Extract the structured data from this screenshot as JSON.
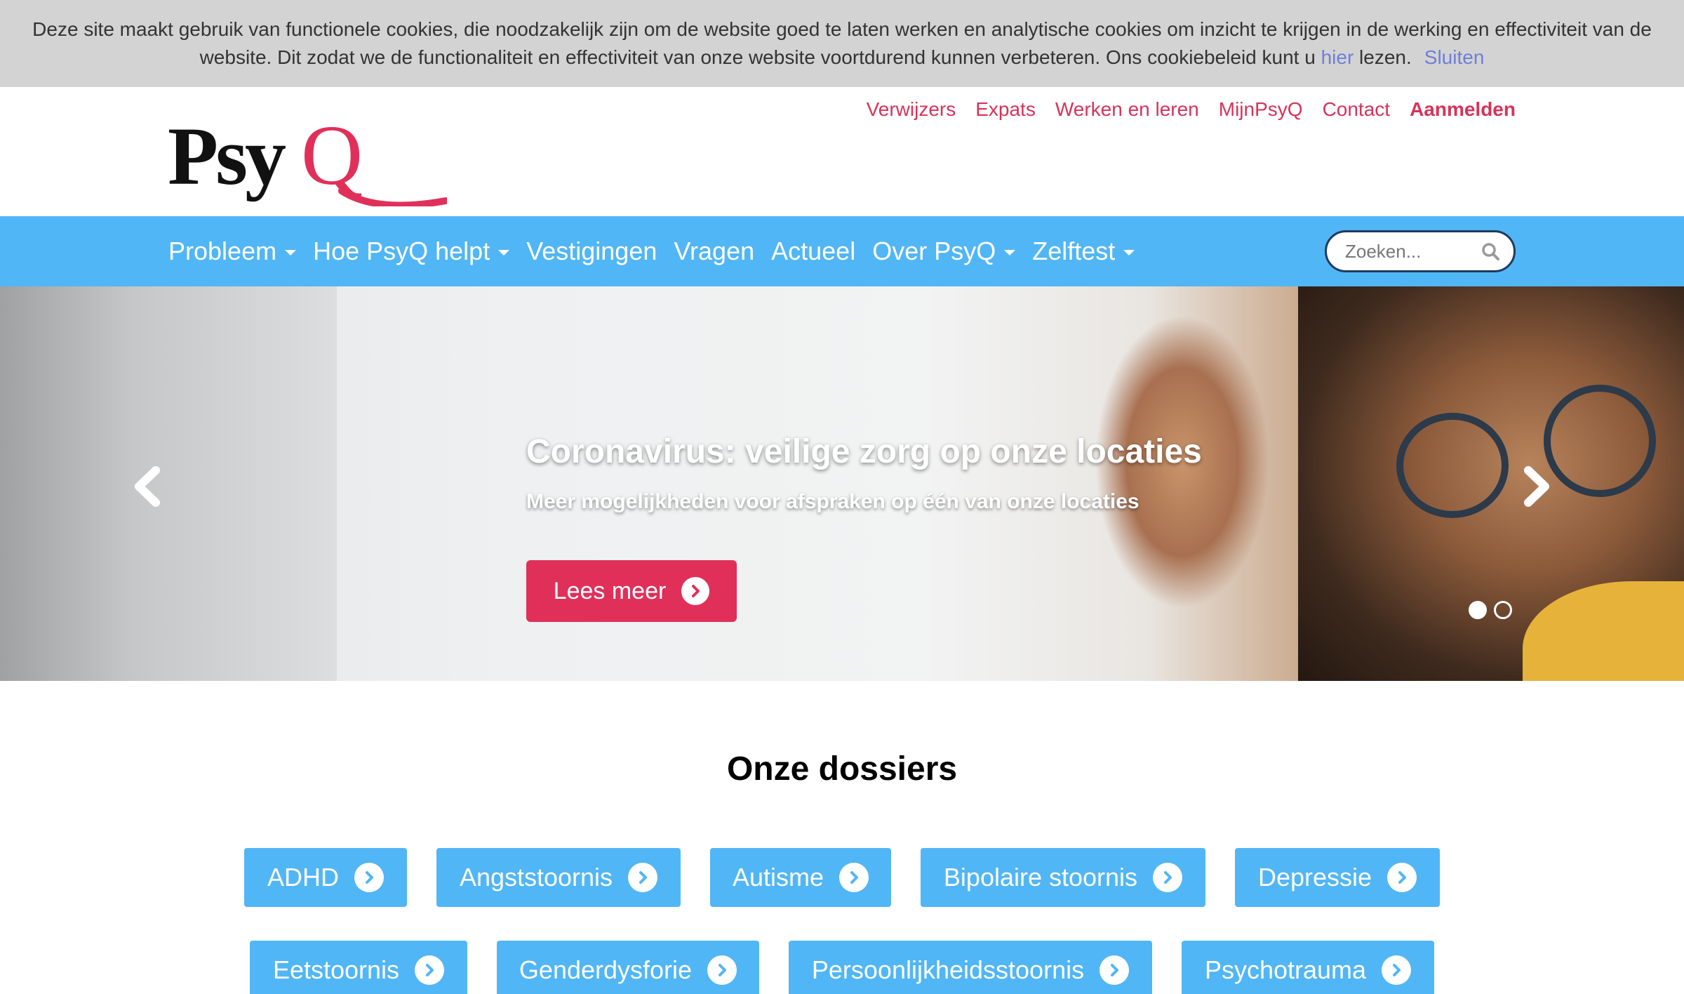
{
  "cookie": {
    "text": "Deze site maakt gebruik van functionele cookies, die noodzakelijk zijn om de website goed te laten werken en analytische cookies om inzicht te krijgen in de werking en effectiviteit van de website. Dit zodat we de functionaliteit en effectiviteit van onze website voortdurend kunnen verbeteren. Ons cookiebeleid kunt u ",
    "link_label": "hier",
    "after_link": " lezen.",
    "close_label": "Sluiten"
  },
  "header": {
    "logo_text": "PsyQ",
    "top_links": [
      "Verwijzers",
      "Expats",
      "Werken en leren",
      "MijnPsyQ",
      "Contact"
    ],
    "login_label": "Aanmelden"
  },
  "nav": {
    "items": [
      {
        "label": "Probleem",
        "dropdown": true
      },
      {
        "label": "Hoe PsyQ helpt",
        "dropdown": true
      },
      {
        "label": "Vestigingen",
        "dropdown": false
      },
      {
        "label": "Vragen",
        "dropdown": false
      },
      {
        "label": "Actueel",
        "dropdown": false
      },
      {
        "label": "Over PsyQ",
        "dropdown": true
      },
      {
        "label": "Zelftest",
        "dropdown": true
      }
    ],
    "search_placeholder": "Zoeken..."
  },
  "hero": {
    "title": "Coronavirus: veilige zorg op onze locaties",
    "subtitle": "Meer mogelijkheden voor afspraken op één van onze locaties",
    "button_label": "Lees meer",
    "slide_count": 2,
    "active_slide": 1
  },
  "dossiers": {
    "title": "Onze dossiers",
    "items": [
      "ADHD",
      "Angststoornis",
      "Autisme",
      "Bipolaire stoornis",
      "Depressie",
      "Eetstoornis",
      "Genderdysforie",
      "Persoonlijkheidsstoornis",
      "Psychotrauma"
    ]
  },
  "colors": {
    "brand_red": "#e0305a",
    "nav_blue": "#51b6f5",
    "cookie_bg": "#d3d3d3",
    "link_purple": "#6f7fd6"
  }
}
